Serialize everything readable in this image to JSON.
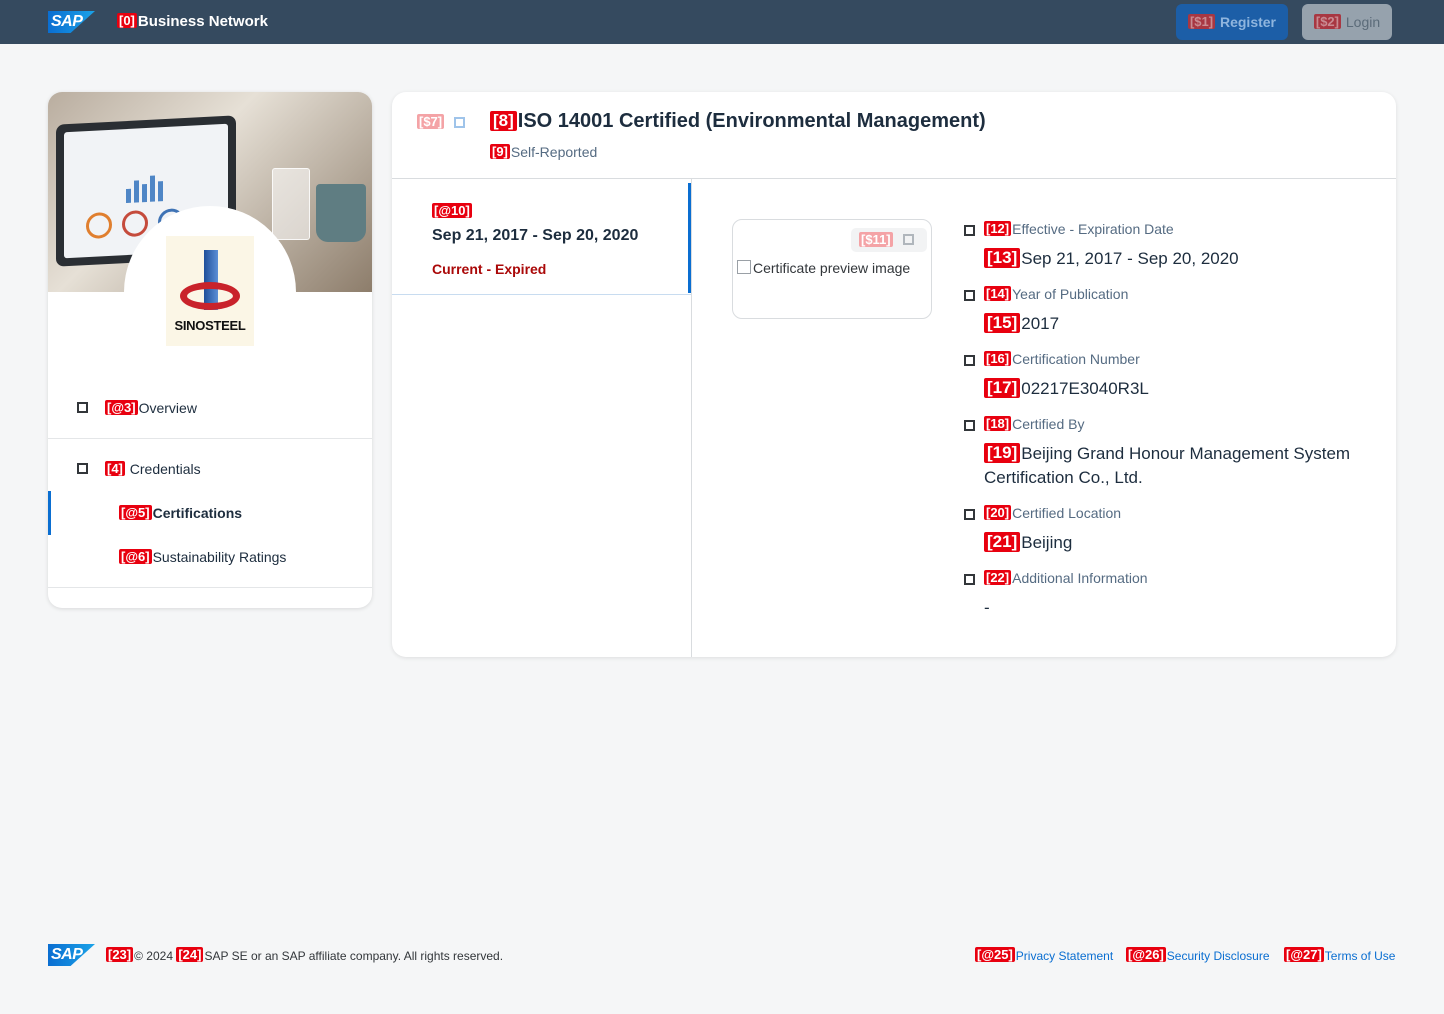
{
  "header": {
    "logo": "SAP",
    "brand_tag": "[0]",
    "brand": "Business Network",
    "register_tag": "[$1]",
    "register": "Register",
    "login_tag": "[$2]",
    "login": "Login"
  },
  "profile": {
    "company_logo_text": "SINOSTEEL",
    "nav": [
      {
        "tag": "[@3]",
        "label": "Overview"
      },
      {
        "tag": "[4]",
        "label": "Credentials"
      },
      {
        "tag": "[@5]",
        "label": "Certifications"
      },
      {
        "tag": "[@6]",
        "label": "Sustainability Ratings"
      }
    ]
  },
  "certificate": {
    "action_tag": "[$7]",
    "title_tag": "[8]",
    "title": "ISO 14001 Certified (Environmental Management)",
    "subtitle_tag": "[9]",
    "subtitle": "Self-Reported",
    "period_tag": "[@10]",
    "period": "Sep 21, 2017 - Sep 20, 2020",
    "period_status": "Current - Expired",
    "preview_tag": "[$11]",
    "preview_alt": "Certificate preview image",
    "fields": [
      {
        "label_tag": "[12]",
        "label": "Effective - Expiration Date",
        "value_tag": "[13]",
        "value": "Sep 21, 2017 - Sep 20, 2020"
      },
      {
        "label_tag": "[14]",
        "label": "Year of Publication",
        "value_tag": "[15]",
        "value": "2017"
      },
      {
        "label_tag": "[16]",
        "label": "Certification Number",
        "value_tag": "[17]",
        "value": "02217E3040R3L"
      },
      {
        "label_tag": "[18]",
        "label": "Certified By",
        "value_tag": "[19]",
        "value": "Beijing Grand Honour Management System Certification Co., Ltd."
      },
      {
        "label_tag": "[20]",
        "label": "Certified Location",
        "value_tag": "[21]",
        "value": "Beijing"
      },
      {
        "label_tag": "[22]",
        "label": "Additional Information",
        "value_tag": "",
        "value": "-"
      }
    ]
  },
  "footer": {
    "logo": "SAP",
    "copyright_tag": "[23]",
    "copyright": "© 2024",
    "company_tag": "[24]",
    "company": "SAP SE or an SAP affiliate company. All rights reserved.",
    "links": [
      {
        "tag": "[@25]",
        "label": "Privacy Statement"
      },
      {
        "tag": "[@26]",
        "label": "Security Disclosure"
      },
      {
        "tag": "[@27]",
        "label": "Terms of Use"
      }
    ]
  },
  "colors": {
    "topbar": "#354a5f",
    "accent": "#0a6ed1",
    "expired": "#aa0808",
    "tag": "#e8000f"
  }
}
